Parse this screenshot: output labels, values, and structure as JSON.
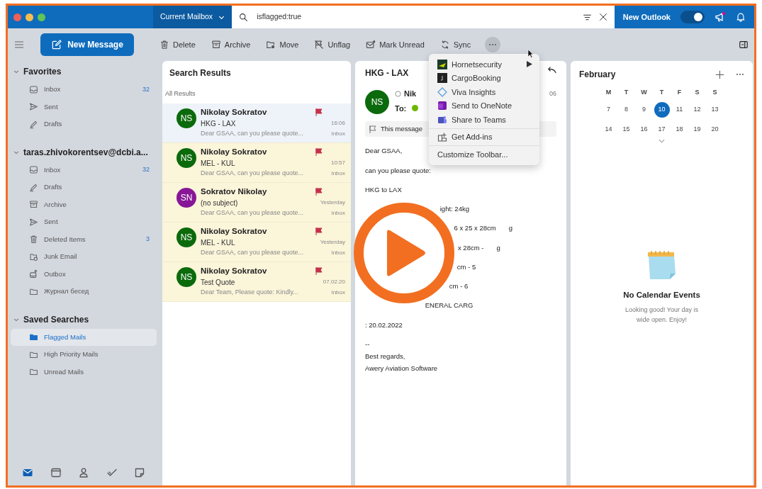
{
  "title_bar": {
    "scope": "Current Mailbox",
    "search_value": "isflagged:true",
    "new_outlook_label": "New Outlook",
    "new_outlook_on": true,
    "notification_dot": true
  },
  "toolbar": {
    "new_message": "New Message",
    "more_pressed": true,
    "actions": [
      {
        "label": "Delete",
        "kind": "trash"
      },
      {
        "label": "Archive",
        "kind": "archive"
      },
      {
        "label": "Move",
        "kind": "move"
      },
      {
        "label": "Unflag",
        "kind": "unflag"
      },
      {
        "label": "Mark Unread",
        "kind": "unread"
      },
      {
        "label": "Sync",
        "kind": "sync"
      }
    ]
  },
  "more_menu": {
    "groups": [
      [
        {
          "label": "Hornetsecurity",
          "kind": "hornet",
          "submenu": true
        },
        {
          "label": "CargoBooking",
          "kind": "cargo",
          "submenu": false
        },
        {
          "label": "Viva Insights",
          "kind": "viva",
          "submenu": false
        },
        {
          "label": "Send to OneNote",
          "kind": "onenote",
          "submenu": false
        },
        {
          "label": "Share to Teams",
          "kind": "teams",
          "submenu": false
        }
      ],
      [
        {
          "label": "Get Add-ins",
          "kind": "addins",
          "submenu": false
        }
      ],
      [
        {
          "label": "Customize Toolbar...",
          "kind": "none",
          "submenu": false
        }
      ]
    ]
  },
  "sidebar": {
    "groups": [
      {
        "title": "Favorites",
        "expanded": true,
        "items": [
          {
            "label": "Inbox",
            "kind": "inbox",
            "count": "32",
            "selected": false
          },
          {
            "label": "Sent",
            "kind": "sent",
            "selected": false
          },
          {
            "label": "Drafts",
            "kind": "drafts",
            "selected": false
          }
        ]
      },
      {
        "title": "taras.zhivokorentsev@dcbi.a...",
        "expanded": true,
        "items": [
          {
            "label": "Inbox",
            "kind": "inbox",
            "count": "32",
            "selected": false
          },
          {
            "label": "Drafts",
            "kind": "drafts",
            "selected": false
          },
          {
            "label": "Archive",
            "kind": "archive",
            "selected": false
          },
          {
            "label": "Sent",
            "kind": "sent",
            "selected": false
          },
          {
            "label": "Deleted Items",
            "kind": "trash",
            "count": "3",
            "selected": false
          },
          {
            "label": "Junk Email",
            "kind": "junk",
            "selected": false
          },
          {
            "label": "Outbox",
            "kind": "outbox",
            "selected": false
          },
          {
            "label": "Журнал бесед",
            "kind": "folder",
            "selected": false
          }
        ]
      },
      {
        "title": "Saved Searches",
        "expanded": true,
        "items": [
          {
            "label": "Flagged Mails",
            "kind": "folder",
            "selected": true
          },
          {
            "label": "High Priority Mails",
            "kind": "folder",
            "selected": false
          },
          {
            "label": "Unread Mails",
            "kind": "folder",
            "selected": false
          }
        ]
      }
    ],
    "bottom_nav": [
      {
        "kind": "mail",
        "selected": true
      },
      {
        "kind": "calendar",
        "selected": false
      },
      {
        "kind": "people",
        "selected": false
      },
      {
        "kind": "tasks",
        "selected": false
      },
      {
        "kind": "notes",
        "selected": false
      }
    ]
  },
  "message_list": {
    "title": "Search Results",
    "subtitle": "All Results",
    "messages": [
      {
        "initials": "NS",
        "color": "#0b6a0b",
        "sender": "Nikolay Sokratov",
        "subject": "HKG - LAX",
        "time": "16:06",
        "preview": "Dear GSAA, can you please quote...",
        "folder": "Inbox",
        "flagged": true,
        "selected": true
      },
      {
        "initials": "NS",
        "color": "#0b6a0b",
        "sender": "Nikolay Sokratov",
        "subject": "MEL - KUL",
        "time": "10:57",
        "preview": "Dear GSAA, can you please quote...",
        "folder": "Inbox",
        "flagged": true,
        "selected": false
      },
      {
        "initials": "SN",
        "color": "#881798",
        "sender": "Sokratov Nikolay",
        "subject": "(no subject)",
        "time": "Yesterday",
        "preview": "Dear GSAA, can you please quote...",
        "folder": "Inbox",
        "flagged": true,
        "selected": false
      },
      {
        "initials": "NS",
        "color": "#0b6a0b",
        "sender": "Nikolay Sokratov",
        "subject": "MEL - KUL",
        "time": "Yesterday",
        "preview": "Dear GSAA, can you please quote...",
        "folder": "Inbox",
        "flagged": true,
        "selected": false
      },
      {
        "initials": "NS",
        "color": "#0b6a0b",
        "sender": "Nikolay Sokratov",
        "subject": "Test Quote",
        "time": "07.02.20",
        "preview": "Dear Team, Please quote: Kindly...",
        "folder": "Inbox",
        "flagged": true,
        "selected": false
      }
    ]
  },
  "reading_pane": {
    "subject": "HKG - LAX",
    "initials": "NS",
    "sender": "Nik",
    "to_label": "To:",
    "time": "06",
    "banner": "This message",
    "body": [
      {
        "segments": [
          "Dear GSAA,"
        ]
      },
      {
        "segments": [
          "can you please quote:"
        ]
      },
      {
        "segments": [
          "HKG to LAX"
        ]
      },
      {
        "segments": [
          "ight: 24kg"
        ]
      },
      {
        "segments": [
          "6 x 25 x 28cm",
          "g"
        ]
      },
      {
        "segments": [
          "x 28cm -",
          "g"
        ]
      },
      {
        "segments": [
          "cm - 5"
        ]
      },
      {
        "segments": [
          "cm - 6"
        ]
      },
      {
        "segments": [
          "ENERAL CARG"
        ]
      },
      {
        "segments": [
          ": 20.02.2022"
        ]
      },
      {
        "segments": [
          "--"
        ]
      },
      {
        "segments": [
          "Best regards,"
        ]
      },
      {
        "segments": [
          "Awery Aviation Software"
        ]
      }
    ]
  },
  "calendar": {
    "month": "February",
    "weekdays": [
      "M",
      "T",
      "W",
      "T",
      "F",
      "S",
      "S"
    ],
    "weeks": [
      [
        {
          "day": "7",
          "selected": false
        },
        {
          "day": "8",
          "selected": false
        },
        {
          "day": "9",
          "selected": false
        },
        {
          "day": "10",
          "selected": true
        },
        {
          "day": "11",
          "selected": false
        },
        {
          "day": "12",
          "selected": false
        },
        {
          "day": "13",
          "selected": false
        }
      ],
      [
        {
          "day": "14",
          "selected": false
        },
        {
          "day": "15",
          "selected": false
        },
        {
          "day": "16",
          "selected": false
        },
        {
          "day": "17",
          "selected": false
        },
        {
          "day": "18",
          "selected": false
        },
        {
          "day": "19",
          "selected": false
        },
        {
          "day": "20",
          "selected": false
        }
      ]
    ],
    "empty_title": "No Calendar Events",
    "empty_text": "Looking good! Your day is wide open. Enjoy!"
  }
}
